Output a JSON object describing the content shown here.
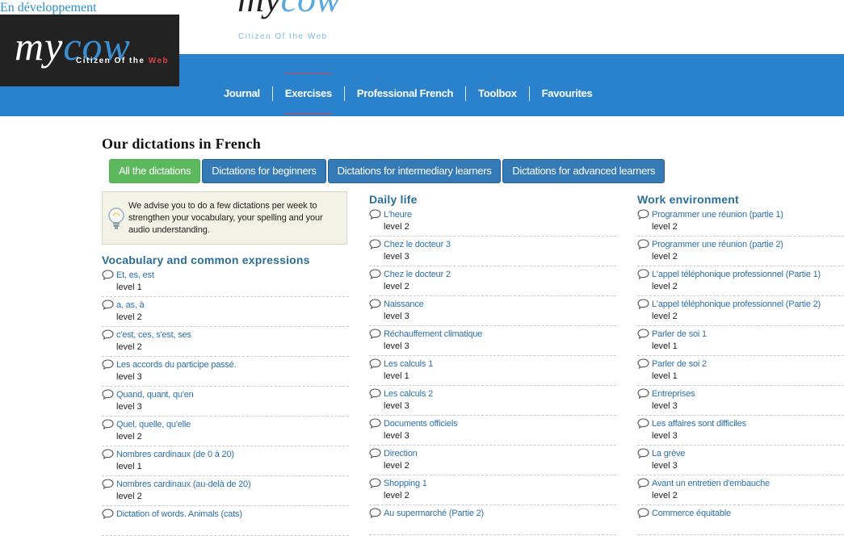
{
  "dev_banner": "En développement",
  "logo": {
    "word_my": "my",
    "word_cow": "cow",
    "tagline_main": "Citizen Of the ",
    "tagline_web": "Web"
  },
  "logo_header": {
    "word_my": "my",
    "word_cow": "cow",
    "tagline": "Citizen Of the Web"
  },
  "nav": [
    {
      "label": "Journal",
      "active": false
    },
    {
      "label": "Exercises",
      "active": true
    },
    {
      "label": "Professional French",
      "active": false
    },
    {
      "label": "Toolbox",
      "active": false
    },
    {
      "label": "Favourites",
      "active": false
    }
  ],
  "page_title": "Our dictations in French",
  "filters": [
    {
      "label": "All the dictations",
      "active": true
    },
    {
      "label": "Dictations for beginners",
      "active": false
    },
    {
      "label": "Dictations for intermediary learners",
      "active": false
    },
    {
      "label": "Dictations for advanced learners",
      "active": false
    }
  ],
  "advice": "We advise you to do a few dictations per week to strengthen your vocabulary, your spelling and your audio understanding.",
  "colors": {
    "nav_bg": "#2b82cc",
    "active_filter": "#5cb85c",
    "filter": "#337ab7",
    "heading": "#2a6e98",
    "link": "#2b6fa8",
    "nav_active_line": "#d9434d"
  },
  "columns": [
    {
      "heading": "Vocabulary and common expressions",
      "items": [
        {
          "title": "Et, es, est",
          "level": "level 1"
        },
        {
          "title": "a, as, à",
          "level": "level 2"
        },
        {
          "title": "c'est, ces, s'est, ses",
          "level": "level 2"
        },
        {
          "title": "Les accords du participe passé.",
          "level": "level 3"
        },
        {
          "title": "Quand, quant, qu'en",
          "level": "level 3"
        },
        {
          "title": "Quel, quelle, qu'elle",
          "level": "level 2"
        },
        {
          "title": "Nombres cardinaux (de 0 à 20)",
          "level": "level 1"
        },
        {
          "title": "Nombres cardinaux (au-delà de 20)",
          "level": "level 2"
        },
        {
          "title": "Dictation of words. Animals (cats)",
          "level": ""
        }
      ]
    },
    {
      "heading": "Daily life",
      "items": [
        {
          "title": "L'heure",
          "level": "level 2"
        },
        {
          "title": "Chez le docteur 3",
          "level": "level 3"
        },
        {
          "title": "Chez le docteur 2",
          "level": "level 2"
        },
        {
          "title": "Naissance",
          "level": "level 3"
        },
        {
          "title": "Réchauffement climatique",
          "level": "level 3"
        },
        {
          "title": "Les calculs 1",
          "level": "level 1"
        },
        {
          "title": "Les calculs 2",
          "level": "level 3"
        },
        {
          "title": "Documents officiels",
          "level": "level 3"
        },
        {
          "title": "Direction",
          "level": "level 2"
        },
        {
          "title": "Shopping 1",
          "level": "level 2"
        },
        {
          "title": "Au supermarché (Partie 2)",
          "level": ""
        }
      ]
    },
    {
      "heading": "Work environment",
      "items": [
        {
          "title": "Programmer une réunion (partie 1)",
          "level": "level 2"
        },
        {
          "title": "Programmer une réunion (partie 2)",
          "level": "level 2"
        },
        {
          "title": "L'appel téléphonique professionnel (Partie 1)",
          "level": "level 2"
        },
        {
          "title": "L'appel téléphonique professionnel (Partie 2)",
          "level": "level 2"
        },
        {
          "title": "Parler de soi 1",
          "level": "level 1"
        },
        {
          "title": "Parler de soi 2",
          "level": "level 1"
        },
        {
          "title": "Entreprises",
          "level": "level 3"
        },
        {
          "title": "Les affaires sont difficiles",
          "level": "level 3"
        },
        {
          "title": "La grève",
          "level": "level 3"
        },
        {
          "title": "Avant un entretien d'embauche",
          "level": "level 2"
        },
        {
          "title": "Commerce équitable",
          "level": ""
        }
      ]
    }
  ]
}
